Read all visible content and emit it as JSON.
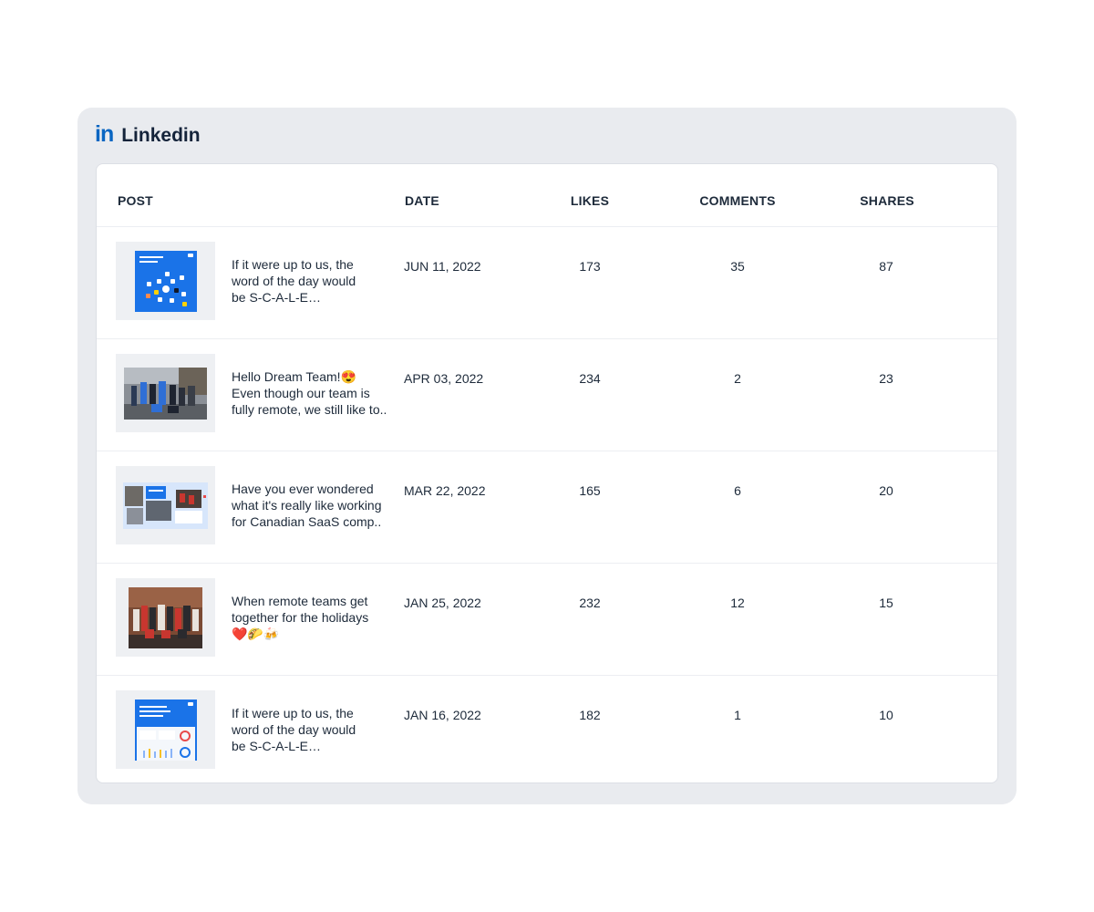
{
  "widget": {
    "logo_text": "in",
    "title": "Linkedin",
    "brand_color": "#0a66c2"
  },
  "table": {
    "headers": {
      "post": "POST",
      "date": "DATE",
      "likes": "LIKES",
      "comments": "COMMENTS",
      "shares": "SHARES"
    },
    "rows": [
      {
        "thumb_icon": "dashboard-graphic-thumbnail",
        "text_lines": [
          "If it were up to us, the",
          "word of the day would",
          "be S-C-A-L-E…"
        ],
        "date": "JUN 11, 2022",
        "likes": "173",
        "comments": "35",
        "shares": "87"
      },
      {
        "thumb_icon": "team-photo-thumbnail",
        "text_lines": [
          "Hello Dream Team!😍",
          "Even though our team is",
          "fully remote, we still like to.."
        ],
        "date": "APR 03, 2022",
        "likes": "234",
        "comments": "2",
        "shares": "23"
      },
      {
        "thumb_icon": "collage-thumbnail",
        "text_lines": [
          "Have you ever wondered",
          "what it's really like working",
          "for Canadian SaaS comp.."
        ],
        "date": "MAR 22, 2022",
        "likes": "165",
        "comments": "6",
        "shares": "20"
      },
      {
        "thumb_icon": "holiday-photo-thumbnail",
        "text_lines": [
          "When remote teams get",
          "together for the holidays",
          "❤️🌮🍻"
        ],
        "date": "JAN 25, 2022",
        "likes": "232",
        "comments": "12",
        "shares": "15"
      },
      {
        "thumb_icon": "marketing-dashboard-thumbnail",
        "text_lines": [
          "If it were up to us, the",
          "word of the day would",
          "be S-C-A-L-E…"
        ],
        "date": "JAN 16, 2022",
        "likes": "182",
        "comments": "1",
        "shares": "10"
      }
    ]
  }
}
